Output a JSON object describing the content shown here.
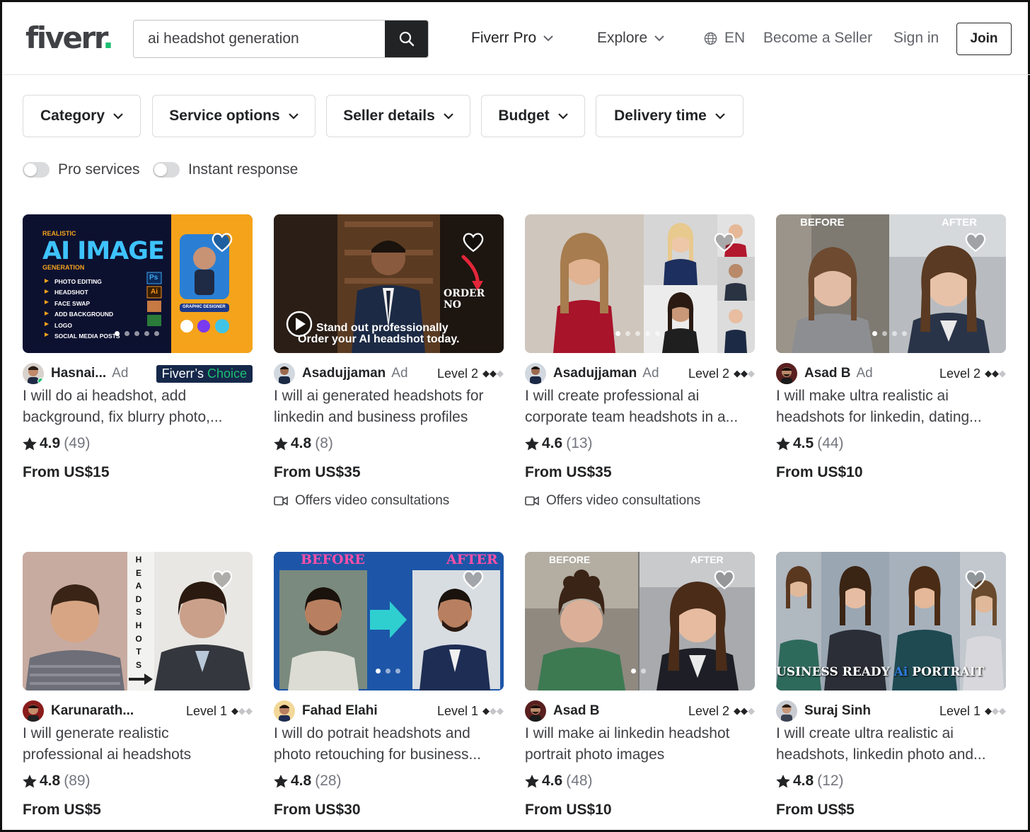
{
  "header": {
    "logo": "fiverr",
    "logo_dot": ".",
    "search_value": "ai headshot generation",
    "nav": {
      "fiverr_pro": "Fiverr Pro",
      "explore": "Explore",
      "language": "EN",
      "become_seller": "Become a Seller",
      "sign_in": "Sign in",
      "join": "Join"
    }
  },
  "filters": {
    "category": "Category",
    "service_options": "Service options",
    "seller_details": "Seller details",
    "budget": "Budget",
    "delivery_time": "Delivery time"
  },
  "toggles": {
    "pro_services": "Pro services",
    "instant_response": "Instant response"
  },
  "gigs": [
    {
      "seller": "Hasnai...",
      "ad": "Ad",
      "badge_part1": "Fiverr’s",
      "badge_part2": "Choice",
      "title": "I will do ai headshot, add background, fix blurry photo,...",
      "rating": "4.9",
      "reviews": "(49)",
      "price": "From US$15",
      "thumb_text": {
        "eyebrow": "REALISTIC",
        "headline": "AI IMAGE",
        "sub": "GENERATION",
        "bullets": [
          "PHOTO EDITING",
          "HEADSHOT",
          "FACE SWAP",
          "ADD BACKGROUND",
          "LOGO",
          "SOCIAL MEDIA POSTS"
        ],
        "tag": "GRAPHIC DESIGNER",
        "ps": "Ps",
        "ai": "Ai"
      }
    },
    {
      "seller": "Asadujjaman",
      "ad": "Ad",
      "level": "Level 2",
      "title": "I will ai generated headshots for linkedin and business profiles",
      "rating": "4.8",
      "reviews": "(8)",
      "price": "From US$35",
      "video": "Offers video consultations",
      "thumb_text": {
        "line1": "Stand out professionally",
        "line2": "Order your AI headshot today.",
        "order": "ORDER NO"
      }
    },
    {
      "seller": "Asadujjaman",
      "ad": "Ad",
      "level": "Level 2",
      "title": "I will create professional ai corporate team headshots in a...",
      "rating": "4.6",
      "reviews": "(13)",
      "price": "From US$35",
      "video": "Offers video consultations"
    },
    {
      "seller": "Asad B",
      "ad": "Ad",
      "level": "Level 2",
      "title": "I will make ultra realistic ai headshots for linkedin, dating...",
      "rating": "4.5",
      "reviews": "(44)",
      "price": "From US$10",
      "thumb_text": {
        "before": "BEFORE",
        "after": "AFTER"
      }
    },
    {
      "seller": "Karunarath...",
      "level": "Level 1",
      "title": "I will generate realistic professional ai headshots",
      "rating": "4.8",
      "reviews": "(89)",
      "price": "From US$5",
      "thumb_text": {
        "vertical": "HEADSHOTS"
      }
    },
    {
      "seller": "Fahad Elahi",
      "level": "Level 1",
      "title": "I will do potrait headshots and photo retouching for business...",
      "rating": "4.8",
      "reviews": "(28)",
      "price": "From US$30",
      "thumb_text": {
        "before": "BEFORE",
        "after": "AFTER"
      }
    },
    {
      "seller": "Asad B",
      "level": "Level 2",
      "title": "I will make ai linkedin headshot portrait photo images",
      "rating": "4.6",
      "reviews": "(48)",
      "price": "From US$10",
      "thumb_text": {
        "before": "BEFORE",
        "after": "AFTER"
      }
    },
    {
      "seller": "Suraj Sinh",
      "level": "Level 1",
      "title": "I will create ultra realistic ai headshots, linkedin photo and...",
      "rating": "4.8",
      "reviews": "(12)",
      "price": "From US$5",
      "thumb_text": {
        "part1": "USINESS READY ",
        "part2": "Ai",
        "part3": " PORTRAIT"
      }
    }
  ],
  "colors": {
    "brand_green": "#1dbf73",
    "text_dark": "#222325",
    "badge_navy": "#16284a"
  }
}
